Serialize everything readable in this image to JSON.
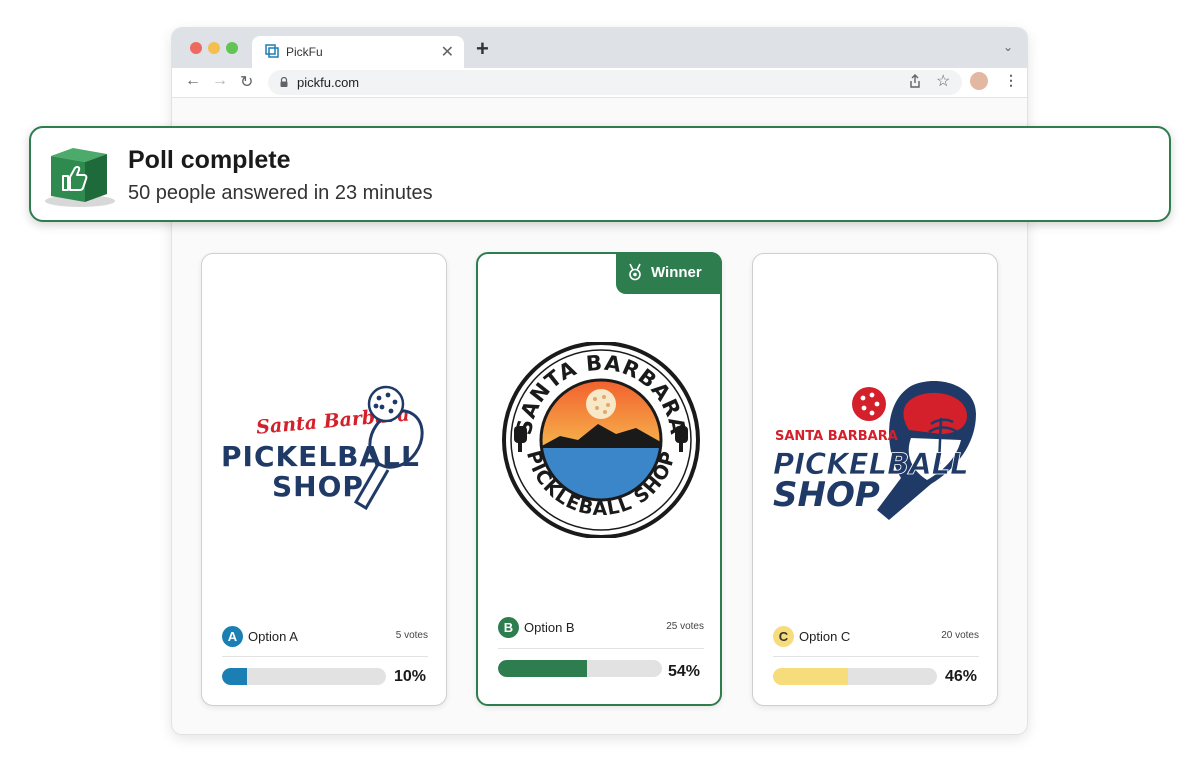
{
  "browser": {
    "tab_title": "PickFu",
    "url": "pickfu.com"
  },
  "toast": {
    "title": "Poll complete",
    "subtitle": "50 people answered in 23 minutes",
    "icon": "thumbs-up-cube-icon"
  },
  "winner": {
    "label": "Winner",
    "icon": "medal-icon"
  },
  "options": [
    {
      "letter": "A",
      "name": "Option A",
      "votes": "5 votes",
      "percent_text": "10%",
      "fill_fraction": 0.15,
      "color": "#1b7fb3",
      "letter_bg": "#1b7fb3",
      "letter_fg": "#ffffff",
      "logo_lines": [
        "Santa Barbara",
        "PICKELBALL",
        "SHOP"
      ]
    },
    {
      "letter": "B",
      "name": "Option B",
      "votes": "25 votes",
      "percent_text": "54%",
      "fill_fraction": 0.54,
      "color": "#2e7d4f",
      "letter_bg": "#2e7d4f",
      "letter_fg": "#ffffff",
      "logo_top": "SANTA BARBARA",
      "logo_bottom": "PICKLEBALL SHOP"
    },
    {
      "letter": "C",
      "name": "Option C",
      "votes": "20 votes",
      "percent_text": "46%",
      "fill_fraction": 0.46,
      "color": "#f7dc7c",
      "letter_bg": "#f7dc7c",
      "letter_fg": "#333333",
      "logo_lines": [
        "SANTA BARBARA",
        "PICKELBALL",
        "SHOP"
      ]
    }
  ],
  "colors": {
    "accent_green": "#2e7d4f",
    "navy": "#1f3a66",
    "red": "#d4202a"
  }
}
